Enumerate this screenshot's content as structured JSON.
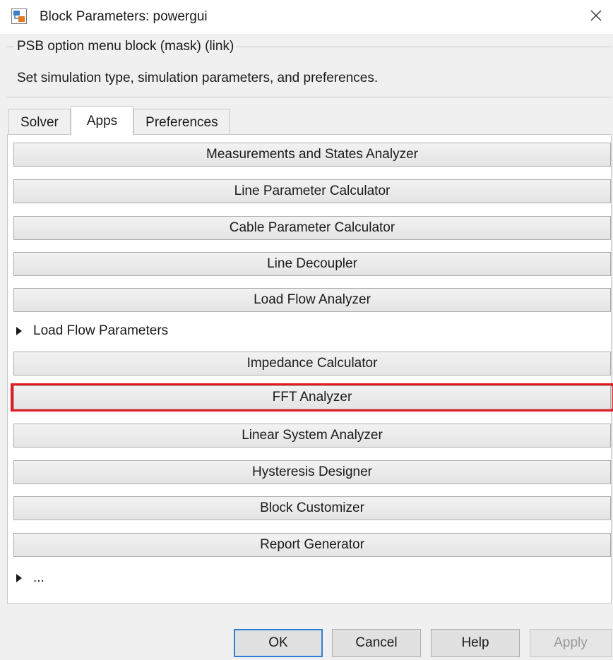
{
  "window": {
    "title": "Block Parameters: powergui",
    "icon": "simulink-block-icon",
    "close_icon": "close-icon"
  },
  "mask": {
    "legend": "PSB option menu block (mask) (link)",
    "description": "Set simulation type, simulation parameters, and preferences."
  },
  "tabs": [
    {
      "label": "Solver",
      "active": false
    },
    {
      "label": "Apps",
      "active": true
    },
    {
      "label": "Preferences",
      "active": false
    }
  ],
  "apps": {
    "buttons": [
      {
        "label": "Measurements and States Analyzer"
      },
      {
        "label": "Line Parameter Calculator"
      },
      {
        "label": "Cable Parameter Calculator"
      },
      {
        "label": "Line Decoupler"
      },
      {
        "label": "Load Flow Analyzer"
      },
      {
        "label": "Impedance Calculator"
      },
      {
        "label": "FFT Analyzer",
        "highlighted": true
      },
      {
        "label": "Linear System Analyzer"
      },
      {
        "label": "Hysteresis Designer"
      },
      {
        "label": "Block Customizer"
      },
      {
        "label": "Report Generator"
      }
    ],
    "load_flow_parameters_label": "Load Flow Parameters",
    "more_label": "...",
    "highlight_color": "#e21b25"
  },
  "footer": {
    "ok_label": "OK",
    "cancel_label": "Cancel",
    "help_label": "Help",
    "apply_label": "Apply"
  }
}
